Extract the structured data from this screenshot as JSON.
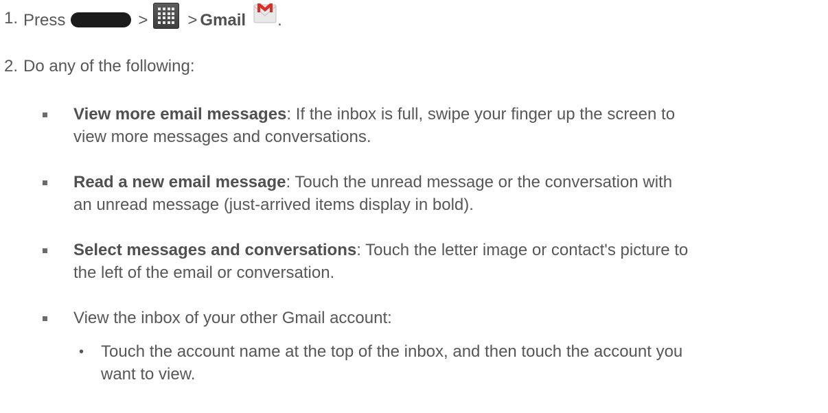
{
  "steps": [
    {
      "number": "1.",
      "press_label": "Press",
      "sep1": ">",
      "sep2": ">",
      "app_name": "Gmail",
      "end": "."
    },
    {
      "number": "2.",
      "text": "Do any of the following:"
    }
  ],
  "bullets": [
    {
      "title": "View more email messages",
      "line1": ": If the inbox is full, swipe your finger up the screen to",
      "line2": "view more messages and conversations."
    },
    {
      "title": "Read a new email message",
      "line1": ": Touch the unread message or the conversation with",
      "line2": "an unread message (just-arrived items display in bold)."
    },
    {
      "title": "Select messages and conversations",
      "line1": ": Touch the letter image or contact's picture to",
      "line2": "the left of the email or conversation."
    },
    {
      "text": "View the inbox of your other Gmail account:"
    }
  ],
  "subbullet": {
    "marker": "•",
    "line1": "Touch the account name at the top of the inbox, and then touch the account you",
    "line2": "want to view."
  },
  "icons": {
    "home_key": "home-key-icon",
    "apps": "apps-grid-icon",
    "gmail": "gmail-envelope-icon"
  },
  "colors": {
    "text": "#575757",
    "gmail_red": "#d93025",
    "key_dark": "#1b1b1b"
  }
}
